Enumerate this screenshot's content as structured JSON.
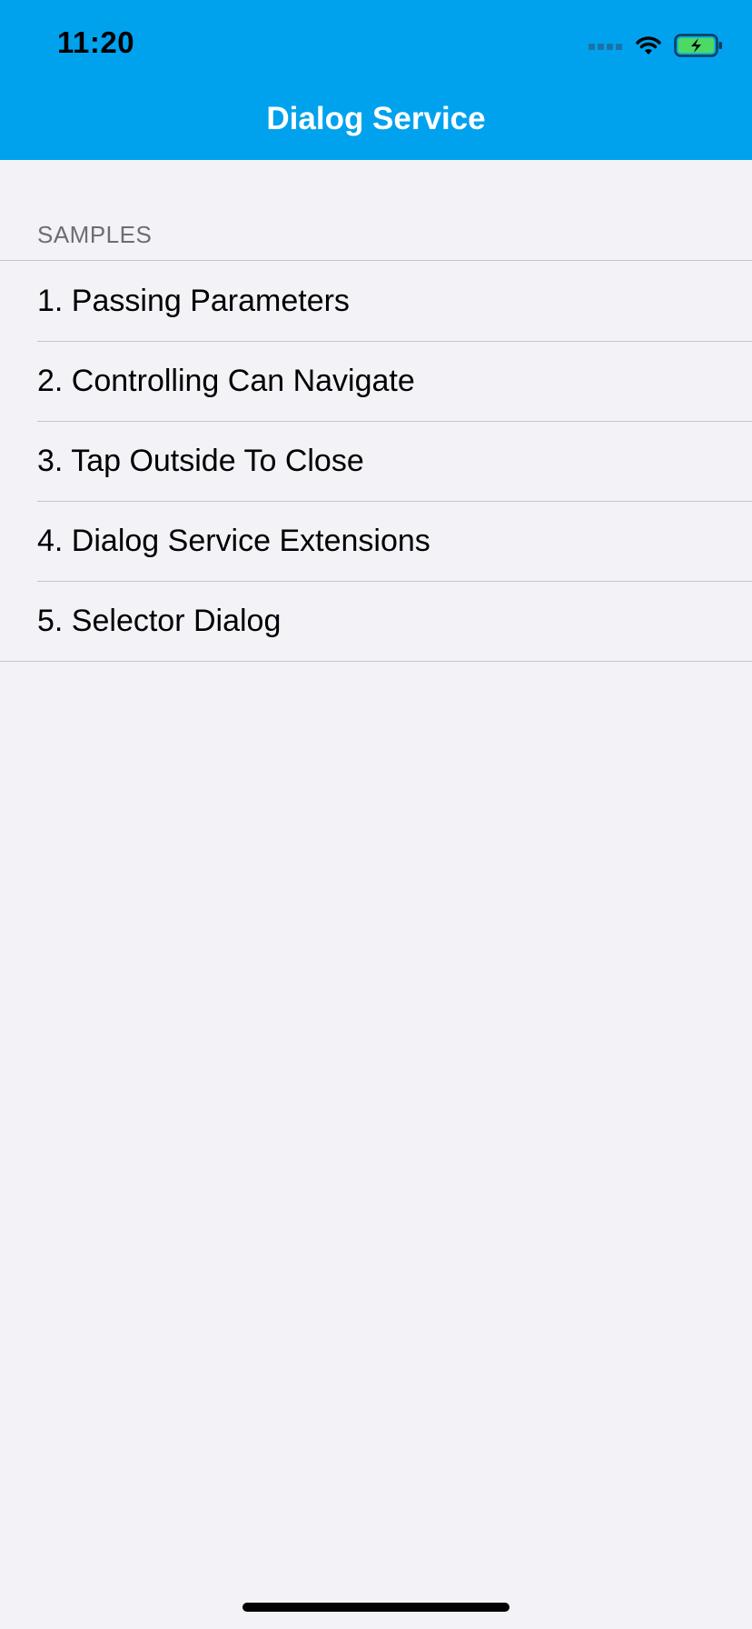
{
  "status_bar": {
    "time": "11:20",
    "icons": [
      "cellular-signal-icon",
      "wifi-icon",
      "battery-charging-icon"
    ]
  },
  "nav": {
    "title": "Dialog Service"
  },
  "section": {
    "header": "SAMPLES",
    "items": [
      {
        "label": "1. Passing Parameters"
      },
      {
        "label": "2. Controlling Can Navigate"
      },
      {
        "label": "3. Tap Outside To Close"
      },
      {
        "label": "4. Dialog Service Extensions"
      },
      {
        "label": "5. Selector Dialog"
      }
    ]
  },
  "colors": {
    "header_bg": "#00a2ee",
    "page_bg": "#f2f2f7",
    "separator": "#c6c6c8",
    "section_text": "#6d6d72",
    "battery_fill": "#4cd964"
  }
}
